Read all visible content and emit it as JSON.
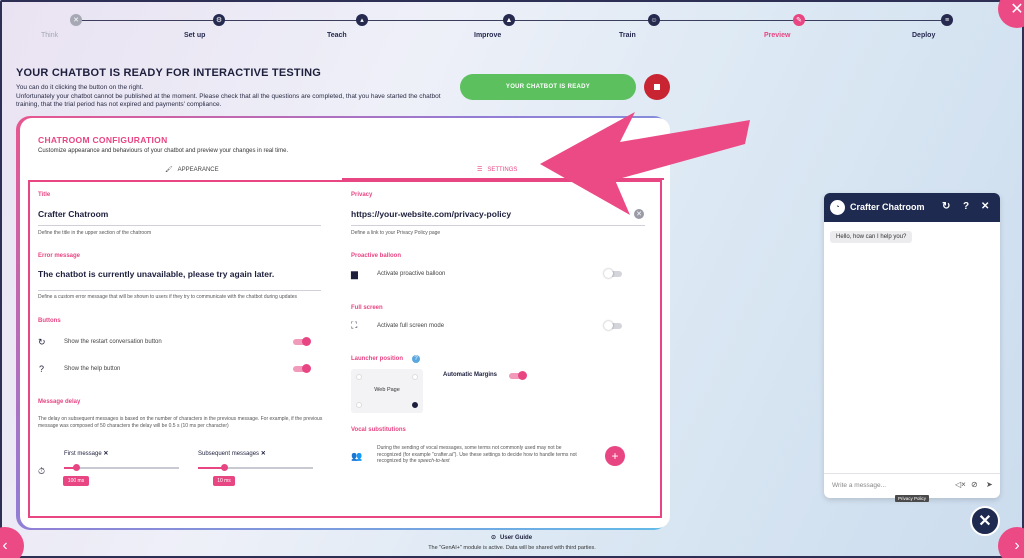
{
  "stepper": {
    "steps": [
      {
        "label": "Think",
        "icon": "x-icon",
        "state": "done"
      },
      {
        "label": "Set up",
        "icon": "gear-icon",
        "state": "todo"
      },
      {
        "label": "Teach",
        "icon": "graduation-cap-icon",
        "state": "todo"
      },
      {
        "label": "Improve",
        "icon": "triangle-icon",
        "state": "todo"
      },
      {
        "label": "Train",
        "icon": "robot-icon",
        "state": "todo"
      },
      {
        "label": "Preview",
        "icon": "pencil-icon",
        "state": "active"
      },
      {
        "label": "Deploy",
        "icon": "list-icon",
        "state": "todo"
      }
    ]
  },
  "header": {
    "title": "YOUR CHATBOT IS READY FOR INTERACTIVE TESTING",
    "line1": "You can do it clicking the button on the right.",
    "line2": "Unfortunately your chatbot cannot be published at the moment. Please check that all the questions are completed, that you have started the chatbot training, that the trial period has not expired and payments' compliance.",
    "ready_button": "YOUR CHATBOT IS READY"
  },
  "config": {
    "title": "CHATROOM CONFIGURATION",
    "subtitle": "Customize appearance and behaviours of your chatbot and preview your changes in real time.",
    "tabs": {
      "appearance": "APPEARANCE",
      "settings": "SETTINGS"
    },
    "title_field": {
      "label": "Title",
      "value": "Crafter Chatroom",
      "hint": "Define the title in the upper section of the chatroom"
    },
    "error_field": {
      "label": "Error message",
      "value": "The chatbot is currently unavailable, please try again later.",
      "hint": "Define a custom error message that will be shown to users if they try to communicate with the chatbot during updates"
    },
    "buttons": {
      "label": "Buttons",
      "restart": "Show the restart conversation button",
      "restart_on": true,
      "help": "Show the help button",
      "help_on": true
    },
    "delay": {
      "label": "Message delay",
      "text": "The delay on subsequent messages is based on the number of characters in the previous message. For example, if the previous message was composed of 50 characters the delay will be 0.5 s (10 ms per character)",
      "first_label": "First message",
      "first_value": "100 ms",
      "first_fraction": 0.1,
      "subsequent_label": "Subsequent messages",
      "subsequent_value": "10 ms",
      "subsequent_fraction": 0.23
    },
    "privacy": {
      "label": "Privacy",
      "value": "https://your-website.com/privacy-policy",
      "hint": "Define a link to your Privacy Policy page"
    },
    "proactive": {
      "label": "Proactive balloon",
      "text": "Activate proactive balloon",
      "on": false
    },
    "fullscreen": {
      "label": "Full screen",
      "text": "Activate full screen mode",
      "on": false
    },
    "launcher": {
      "label": "Launcher position",
      "page_label": "Web Page",
      "margins_label": "Automatic Margins",
      "margins_on": true
    },
    "vocal": {
      "label": "Vocal substitutions",
      "text": "During the sending of vocal messages, some terms not commonly used may not be recognized (for example \"crafter.ai\"). Use these settings to decide how to handle terms not recognized by the",
      "text_italic": "speech-to-text"
    }
  },
  "chat": {
    "title": "Crafter Chatroom",
    "greeting": "Hello, how can I help you?",
    "placeholder": "Write a message...",
    "privacy_tag": "Privacy Policy"
  },
  "footer": {
    "guide": "User Guide",
    "note": "The \"GenAI+\" module is active. Data will be shared with third parties."
  },
  "colors": {
    "accent": "#e84583",
    "navy": "#1e2a4f",
    "green": "#5cc05f",
    "red": "#c82432"
  }
}
